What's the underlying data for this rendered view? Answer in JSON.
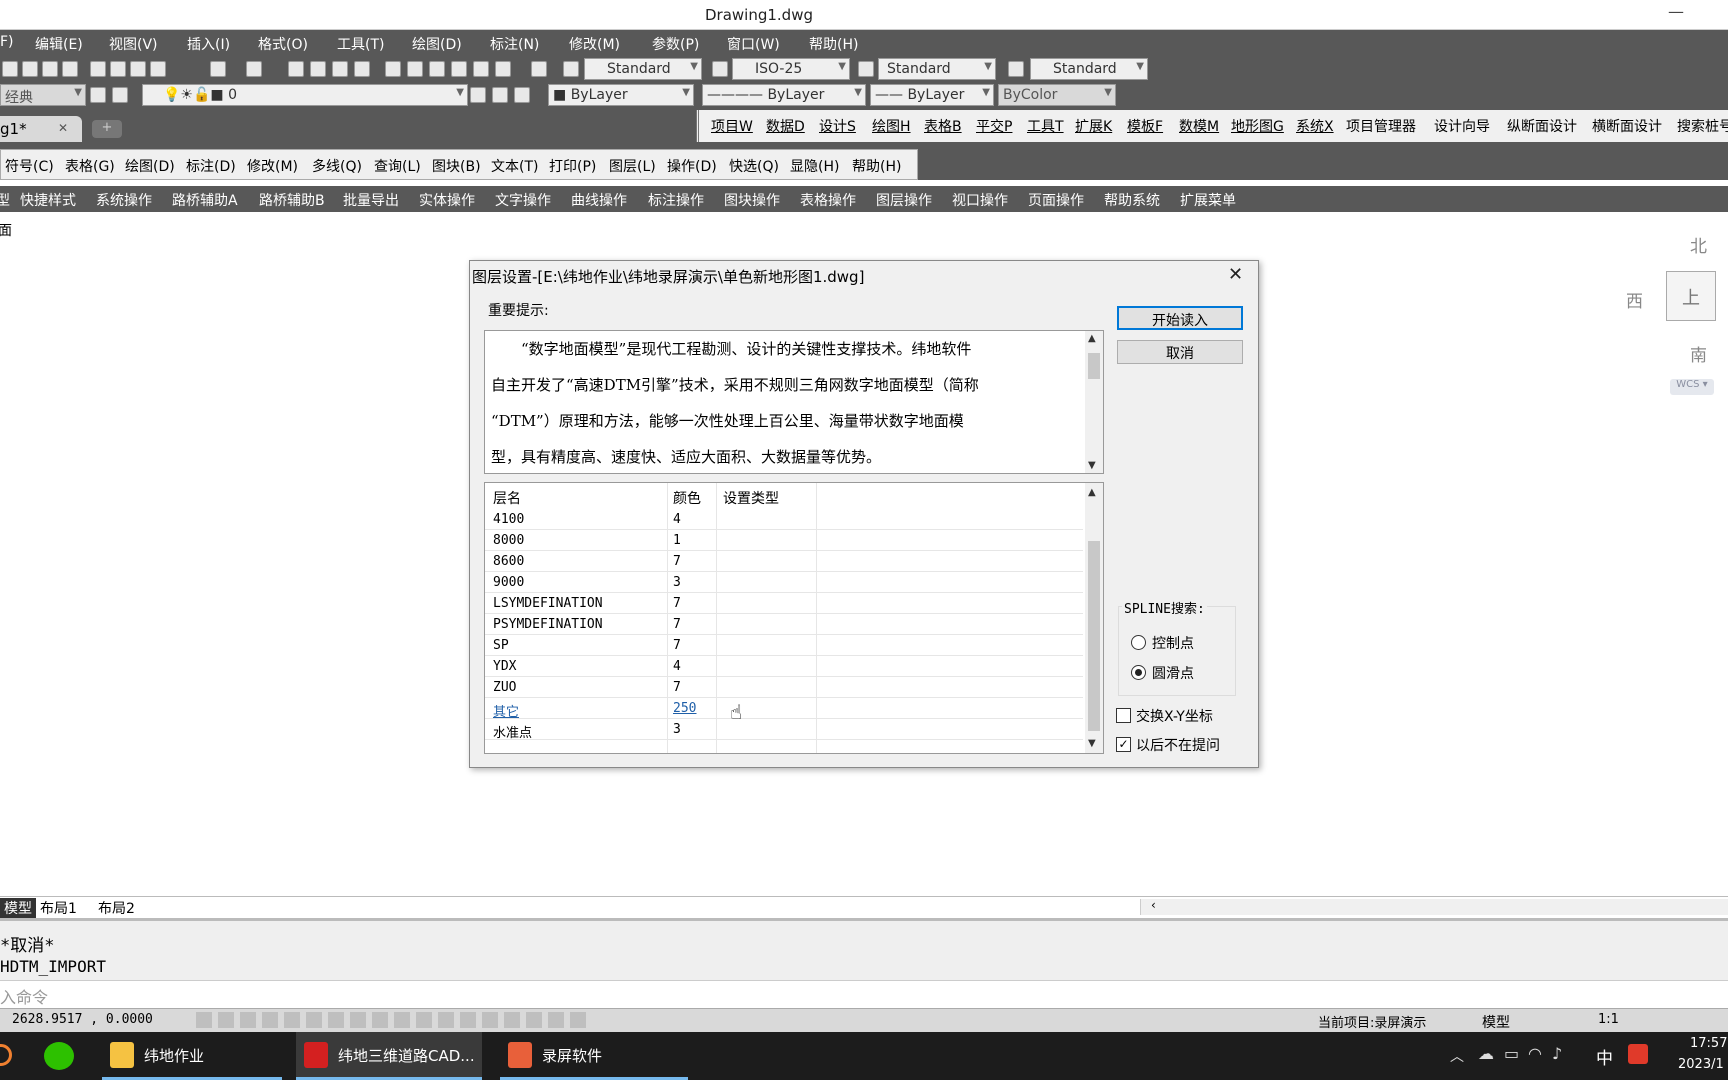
{
  "window": {
    "title": "Drawing1.dwg",
    "min": "—",
    "max": "□"
  },
  "menu": [
    "F)",
    "编辑(E)",
    "视图(V)",
    "插入(I)",
    "格式(O)",
    "工具(T)",
    "绘图(D)",
    "标注(N)",
    "修改(M)",
    "参数(P)",
    "窗口(W)",
    "帮助(H)"
  ],
  "styles": {
    "text": "Standard",
    "dim": "ISO-25",
    "table": "Standard",
    "mleader": "Standard"
  },
  "toolbar2": {
    "workspace": "经典",
    "layer": "0",
    "color": "ByLayer",
    "linetype": "ByLayer",
    "lineweight": "ByLayer",
    "plotstyle": "ByColor"
  },
  "doctab": {
    "label": "g1*",
    "close": "✕",
    "add": "+"
  },
  "right_menu": [
    "项目W",
    "数据D",
    "设计S",
    "绘图H",
    "表格B",
    "平交P",
    "工具T",
    "扩展K",
    "模板F",
    "数模M",
    "地形图G",
    "系统X",
    "项目管理器",
    "设计向导",
    "纵断面设计",
    "横断面设计",
    "搜索桩号"
  ],
  "plugin_menu": [
    "符号(C)",
    "表格(G)",
    "绘图(D)",
    "标注(D)",
    "修改(M)",
    "多线(Q)",
    "查询(L)",
    "图块(B)",
    "文本(T)",
    "打印(P)",
    "图层(L)",
    "操作(D)",
    "快选(Q)",
    "显隐(H)",
    "帮助(H)"
  ],
  "quick_bar": [
    "型",
    "快捷样式",
    "系统操作",
    "路桥辅助A",
    "路桥辅助B",
    "批量导出",
    "实体操作",
    "文字操作",
    "曲线操作",
    "标注操作",
    "图块操作",
    "表格操作",
    "图层操作",
    "视口操作",
    "页面操作",
    "帮助系统",
    "扩展菜单"
  ],
  "canvas_label": "面",
  "compass": {
    "north": "北",
    "west": "西",
    "south": "南",
    "top": "上",
    "wcs": "WCS"
  },
  "dialog": {
    "title": "图层设置-[E:\\纬地作业\\纬地录屏演示\\单色新地形图1.dwg]",
    "note_label": "重要提示:",
    "note_lines": [
      "　　“数字地面模型”是现代工程勘测、设计的关键性支撑技术。纬地软件",
      "自主开发了“高速DTM引擎”技术，采用不规则三角网数字地面模型（简称",
      "“DTM”）原理和方法，能够一次性处理上百公里、海量带状数字地面模",
      "型，具有精度高、速度快、适应大面积、大数据量等优势。"
    ],
    "columns": [
      "层名",
      "颜色",
      "设置类型"
    ],
    "rows": [
      {
        "name": "4100",
        "color": "4",
        "type": ""
      },
      {
        "name": "8000",
        "color": "1",
        "type": ""
      },
      {
        "name": "8600",
        "color": "7",
        "type": ""
      },
      {
        "name": "9000",
        "color": "3",
        "type": ""
      },
      {
        "name": "LSYMDEFINATION",
        "color": "7",
        "type": ""
      },
      {
        "name": "PSYMDEFINATION",
        "color": "7",
        "type": ""
      },
      {
        "name": "SP",
        "color": "7",
        "type": ""
      },
      {
        "name": "YDX",
        "color": "4",
        "type": ""
      },
      {
        "name": "ZUO",
        "color": "7",
        "type": ""
      },
      {
        "name": "其它",
        "color": "250",
        "type": ""
      },
      {
        "name": "水准点",
        "color": "3",
        "type": ""
      }
    ],
    "start_button": "开始读入",
    "cancel_button": "取消",
    "spline_label": "SPLINE搜索:",
    "spline_options": [
      "控制点",
      "圆滑点"
    ],
    "spline_selected": "圆滑点",
    "swap_xy": "交换X-Y坐标",
    "swap_xy_checked": false,
    "no_prompt": "以后不在提问",
    "no_prompt_checked": true
  },
  "layout_tabs": [
    "模型",
    "布局1",
    "布局2"
  ],
  "command": {
    "history": [
      "*取消*",
      "HDTM_IMPORT"
    ],
    "prompt": "入命令"
  },
  "status": {
    "coords": "2628.9517 , 0.0000",
    "project": "当前项目:录屏演示",
    "model": "模型",
    "scale": "1:1"
  },
  "taskbar": {
    "apps": [
      {
        "label": "纬地作业"
      },
      {
        "label": "纬地三维道路CAD..."
      },
      {
        "label": "录屏软件"
      }
    ],
    "ime": "中",
    "time": "17:57",
    "date": "2023/1"
  }
}
